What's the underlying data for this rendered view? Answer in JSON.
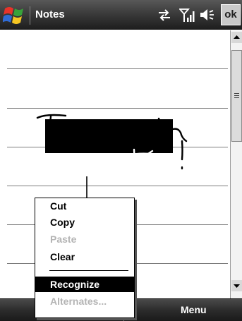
{
  "titlebar": {
    "app_title": "Notes",
    "ok_label": "ok",
    "icons": [
      "windows-start-icon",
      "sync-icon",
      "signal-icon",
      "volume-icon"
    ]
  },
  "context_menu": {
    "items": [
      {
        "label": "Cut",
        "enabled": true
      },
      {
        "label": "Copy",
        "enabled": true
      },
      {
        "label": "Paste",
        "enabled": false
      },
      {
        "label": "Clear",
        "enabled": true
      },
      {
        "label": "Recognize",
        "enabled": true,
        "selected": true
      },
      {
        "label": "Alternates...",
        "enabled": false
      }
    ]
  },
  "softkeys": {
    "right": "Menu"
  },
  "colors": {
    "titlebar": "#3c3c3c",
    "selection": "#000000",
    "disabled_text": "#b4b4b4",
    "logo_red": "#e8332a",
    "logo_green": "#38a33a",
    "logo_blue": "#2f6bd4",
    "logo_yellow": "#f5c623"
  }
}
